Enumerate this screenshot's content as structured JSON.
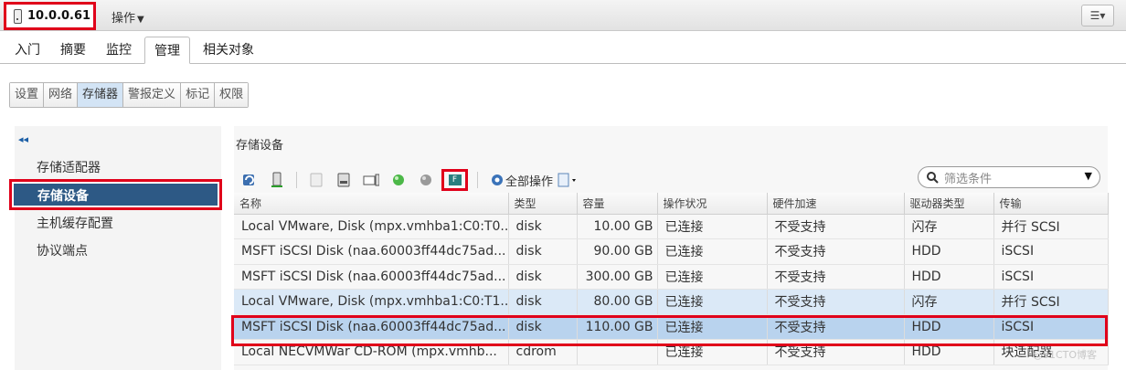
{
  "host": {
    "name": "10.0.0.61",
    "actions_label": "操作"
  },
  "tabs": [
    {
      "label": "入门"
    },
    {
      "label": "摘要"
    },
    {
      "label": "监控"
    },
    {
      "label": "管理"
    },
    {
      "label": "相关对象"
    }
  ],
  "subtabs": [
    {
      "label": "设置"
    },
    {
      "label": "网络"
    },
    {
      "label": "存储器"
    },
    {
      "label": "警报定义"
    },
    {
      "label": "标记"
    },
    {
      "label": "权限"
    }
  ],
  "nav": {
    "items": [
      {
        "label": "存储适配器"
      },
      {
        "label": "存储设备"
      },
      {
        "label": "主机缓存配置"
      },
      {
        "label": "协议端点"
      }
    ]
  },
  "main": {
    "title": "存储设备",
    "all_actions_label": "全部操作",
    "filter_placeholder": "筛选条件"
  },
  "table": {
    "headers": [
      "名称",
      "类型",
      "容量",
      "操作状况",
      "硬件加速",
      "驱动器类型",
      "传输"
    ],
    "rows": [
      [
        "Local VMware, Disk (mpx.vmhba1:C0:T0...",
        "disk",
        "10.00 GB",
        "已连接",
        "不受支持",
        "闪存",
        "并行 SCSI"
      ],
      [
        "MSFT iSCSI Disk (naa.60003ff44dc75ad...",
        "disk",
        "90.00 GB",
        "已连接",
        "不受支持",
        "HDD",
        "iSCSI"
      ],
      [
        "MSFT iSCSI Disk (naa.60003ff44dc75ad...",
        "disk",
        "300.00 GB",
        "已连接",
        "不受支持",
        "HDD",
        "iSCSI"
      ],
      [
        "Local VMware, Disk (mpx.vmhba1:C0:T1...",
        "disk",
        "80.00 GB",
        "已连接",
        "不受支持",
        "闪存",
        "并行 SCSI"
      ],
      [
        "MSFT iSCSI Disk (naa.60003ff44dc75ad...",
        "disk",
        "110.00 GB",
        "已连接",
        "不受支持",
        "HDD",
        "iSCSI"
      ],
      [
        "Local NECVMWar CD-ROM (mpx.vmhb...",
        "cdrom",
        "",
        "已连接",
        "不受支持",
        "HDD",
        "块适配器"
      ]
    ]
  },
  "watermark": "@51CTO博客"
}
